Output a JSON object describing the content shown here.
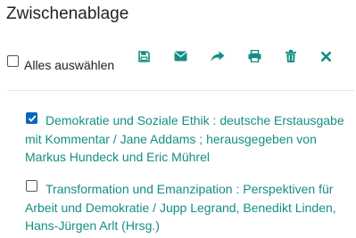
{
  "clipboard": {
    "title": "Zwischenablage",
    "select_all_label": "Alles auswählen",
    "select_all_checked": false
  },
  "toolbar": {
    "icons": [
      {
        "name": "save-icon"
      },
      {
        "name": "envelope-icon"
      },
      {
        "name": "share-arrow-icon"
      },
      {
        "name": "print-icon"
      },
      {
        "name": "trash-icon"
      },
      {
        "name": "close-icon"
      }
    ],
    "accent": "#138f83"
  },
  "items": [
    {
      "checked": true,
      "text": "Demokratie und Soziale Ethik : deutsche Erstausgabe mit Kommentar / Jane Addams ; herausgegeben von Markus Hundeck und Eric Mührel"
    },
    {
      "checked": false,
      "text": "Transformation und Emanzipation : Perspektiven für Arbeit und Demokratie / Jupp Legrand, Benedikt Linden, Hans-Jürgen Arlt (Hrsg.)"
    }
  ],
  "colors": {
    "link": "#138f83",
    "checkbox_checked": "#0a66c2",
    "text": "#222222"
  }
}
